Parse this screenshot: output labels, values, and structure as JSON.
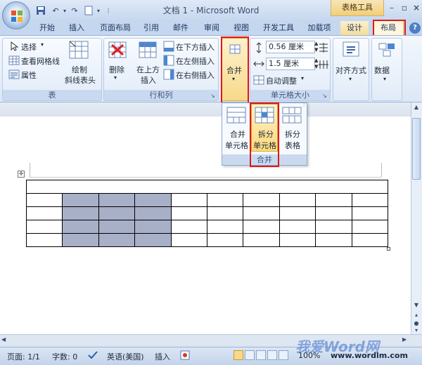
{
  "window": {
    "title": "文档 1 - Microsoft Word",
    "context_tools_label": "表格工具"
  },
  "tabs": [
    {
      "label": "开始"
    },
    {
      "label": "插入"
    },
    {
      "label": "页面布局"
    },
    {
      "label": "引用"
    },
    {
      "label": "邮件"
    },
    {
      "label": "审阅"
    },
    {
      "label": "视图"
    },
    {
      "label": "开发工具"
    },
    {
      "label": "加载项"
    },
    {
      "label": "设计"
    },
    {
      "label": "布局",
      "active": true
    }
  ],
  "ribbon": {
    "table_group": {
      "label": "表",
      "select": "选择",
      "view_gridlines": "查看网格线",
      "properties": "属性",
      "draw_diagonal_line1": "绘制",
      "draw_diagonal_line2": "斜线表头"
    },
    "rows_cols_group": {
      "label": "行和列",
      "delete": "删除",
      "insert_above1": "在上方",
      "insert_above2": "插入",
      "insert_below": "在下方插入",
      "insert_left": "在左侧插入",
      "insert_right": "在右侧插入"
    },
    "merge_group": {
      "label": "合并"
    },
    "cell_size_group": {
      "label": "单元格大小",
      "height_value": "0.56 厘米",
      "width_value": "1.5 厘米",
      "autofit": "自动调整"
    },
    "alignment": "对齐方式",
    "data": "数据"
  },
  "merge_dropdown": {
    "label": "合并",
    "items": [
      {
        "line1": "合并",
        "line2": "单元格"
      },
      {
        "line1": "拆分",
        "line2": "单元格"
      },
      {
        "line1": "拆分",
        "line2": "表格"
      }
    ]
  },
  "status_bar": {
    "page": "页面: 1/1",
    "word_count": "字数: 0",
    "language": "英语(美国)",
    "insert_mode": "插入",
    "zoom": "100%"
  },
  "watermark": {
    "text": "我爱Word网",
    "url": "www.wordlm.com"
  },
  "colors": {
    "highlight_box": "#e01818",
    "selected_cell": "#a8b0c8",
    "context_tab": "#f1cf7a"
  }
}
